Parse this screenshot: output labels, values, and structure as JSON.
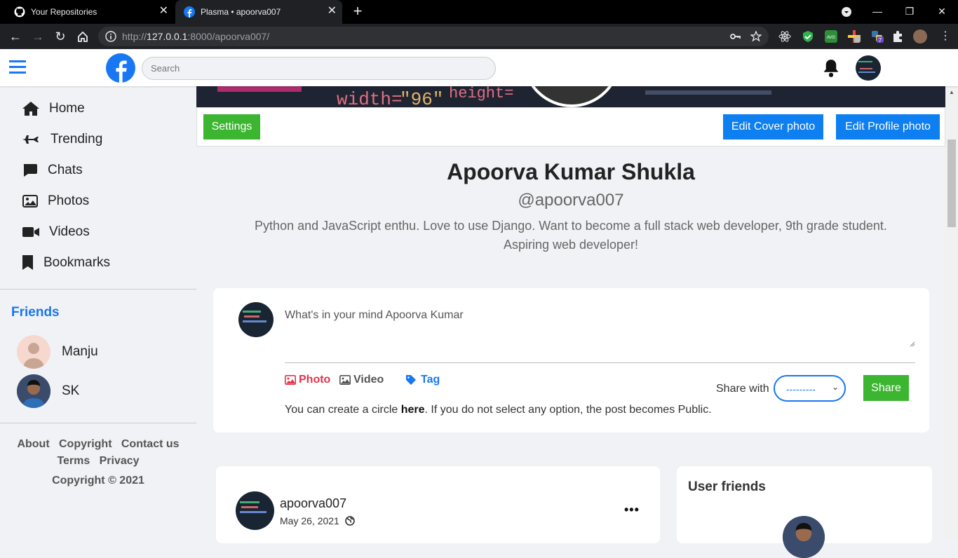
{
  "browser": {
    "tabs": [
      {
        "title": "Your Repositories",
        "icon": "github-icon"
      },
      {
        "title": "Plasma • apoorva007",
        "icon": "facebook-icon"
      }
    ],
    "url_prefix": "http://",
    "url_host": "127.0.0.1",
    "url_rest": ":8000/apoorva007/"
  },
  "header": {
    "search_placeholder": "Search"
  },
  "sidebar": {
    "nav": [
      {
        "label": "Home",
        "icon": "home-icon"
      },
      {
        "label": "Trending",
        "icon": "plane-icon"
      },
      {
        "label": "Chats",
        "icon": "chat-icon"
      },
      {
        "label": "Photos",
        "icon": "photo-icon"
      },
      {
        "label": "Videos",
        "icon": "video-icon"
      },
      {
        "label": "Bookmarks",
        "icon": "bookmark-icon"
      }
    ],
    "friends_title": "Friends",
    "friends": [
      {
        "name": "Manju"
      },
      {
        "name": "SK"
      }
    ],
    "footer": {
      "about": "About",
      "copyright_link": "Copyright",
      "contact": "Contact us",
      "terms": "Terms",
      "privacy": "Privacy",
      "copyright_text": "Copyright © 2021"
    }
  },
  "profile": {
    "settings_label": "Settings",
    "edit_cover_label": "Edit Cover photo",
    "edit_profile_label": "Edit Profile photo",
    "name": "Apoorva Kumar Shukla",
    "username": "@apoorva007",
    "bio_line1": "Python and JavaScript enthu. Love to use Django. Want to become a full stack web developer, 9th grade student.",
    "bio_line2": "Aspiring web developer!"
  },
  "composer": {
    "placeholder": "What's in your mind Apoorva Kumar",
    "photo_label": "Photo",
    "video_label": "Video",
    "tag_label": "Tag",
    "share_with_label": "Share with",
    "share_select_value": "---------",
    "share_button": "Share",
    "circle_text_before": "You can create a circle ",
    "circle_link": "here",
    "circle_text_after": ". If you do not select any option, the post becomes Public."
  },
  "post": {
    "author": "apoorva007",
    "date": "May 26, 2021"
  },
  "user_friends": {
    "title": "User friends"
  },
  "colors": {
    "brand_blue": "#1877f2",
    "button_blue": "#0d7ff0",
    "green": "#3cb531",
    "photo_red": "#e0344a"
  }
}
